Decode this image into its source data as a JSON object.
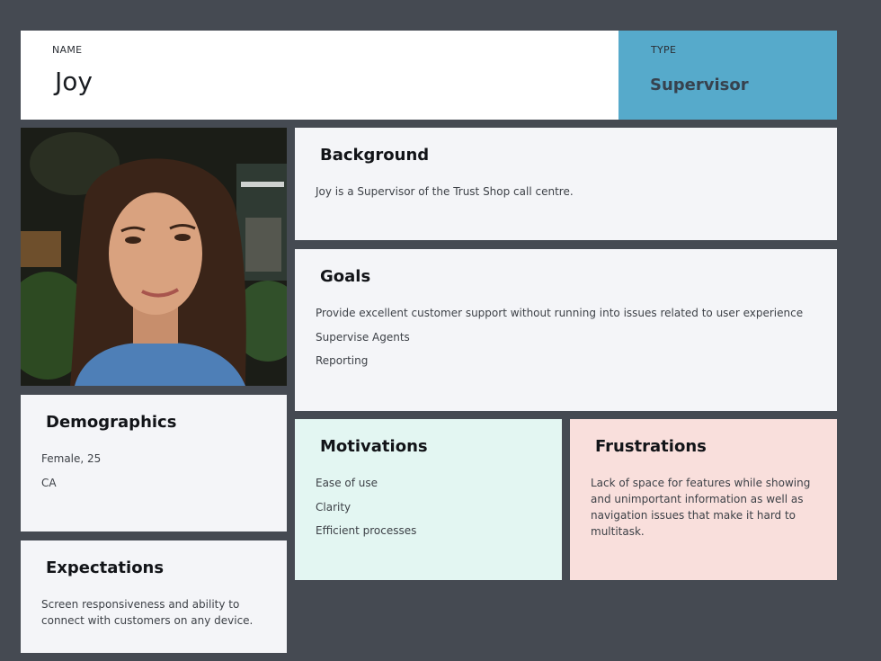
{
  "header": {
    "name_label": "NAME",
    "name_value": "Joy",
    "type_label": "TYPE",
    "type_value": "Supervisor"
  },
  "photo": {
    "description_icon": "persona-photo"
  },
  "background": {
    "title": "Background",
    "text": "Joy is a Supervisor of the Trust Shop call centre."
  },
  "goals": {
    "title": "Goals",
    "items": [
      "Provide excellent customer support without running into issues related to user experience",
      "Supervise Agents",
      "Reporting"
    ]
  },
  "demographics": {
    "title": "Demographics",
    "items": [
      "Female, 25",
      "CA"
    ]
  },
  "motivations": {
    "title": "Motivations",
    "items": [
      "Ease of use",
      "Clarity",
      "Efficient processes"
    ]
  },
  "frustrations": {
    "title": "Frustrations",
    "text": "Lack of space for features while showing and unimportant information as well as navigation issues that make it hard to multitask."
  },
  "expectations": {
    "title": "Expectations",
    "text": "Screen responsiveness and ability to connect with customers on any device."
  },
  "colors": {
    "page_bg": "#454a52",
    "type_bg": "#56aacb",
    "motivations_bg": "#e3f6f2",
    "frustrations_bg": "#f9dfdc",
    "card_bg": "#f4f5f8"
  }
}
